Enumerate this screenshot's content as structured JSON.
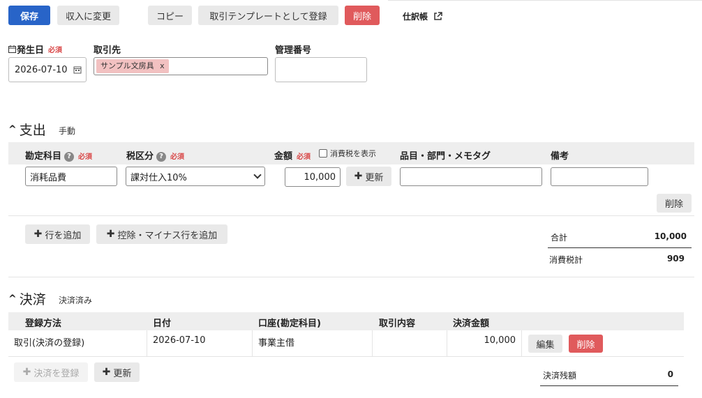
{
  "toolbar": {
    "save": "保存",
    "to_income": "収入に変更",
    "copy": "コピー",
    "register_template": "取引テンプレートとして登録",
    "delete": "削除",
    "journal": "仕訳帳"
  },
  "header_fields": {
    "date_label": "発生日",
    "required": "必須",
    "date_value": "2026-07-10",
    "partner_label": "取引先",
    "partner_tag": "サンプル文房具",
    "tag_remove": "x",
    "mgmt_label": "管理番号",
    "mgmt_value": ""
  },
  "expense": {
    "title": "支出",
    "mode": "手動",
    "headers": {
      "account": "勘定科目",
      "tax": "税区分",
      "amount": "金額",
      "show_tax": "消費税を表示",
      "item": "品目・部門・メモタグ",
      "note": "備考"
    },
    "row": {
      "account": "消耗品費",
      "tax": "課対仕入10%",
      "amount": "10,000",
      "update": "更新",
      "item": "",
      "note": "",
      "delete": "削除"
    },
    "add_row": "行を追加",
    "add_minus_row": "控除・マイナス行を追加",
    "total_label": "合計",
    "total_value": "10,000",
    "tax_label": "消費税計",
    "tax_value": "909"
  },
  "payment": {
    "title": "決済",
    "status": "決済済み",
    "headers": {
      "method": "登録方法",
      "date": "日付",
      "account": "口座(勘定科目)",
      "content": "取引内容",
      "amount": "決済金額"
    },
    "row": {
      "method": "取引(決済の登録)",
      "date": "2026-07-10",
      "account": "事業主借",
      "content": "",
      "amount": "10,000",
      "edit": "編集",
      "delete": "削除"
    },
    "register": "決済を登録",
    "update": "更新",
    "balance_label": "決済残額",
    "balance_value": "0"
  },
  "colors": {
    "primary": "#2864c8",
    "danger": "#e05a5c",
    "required": "#d94848",
    "tag": "#f2c1c1"
  }
}
